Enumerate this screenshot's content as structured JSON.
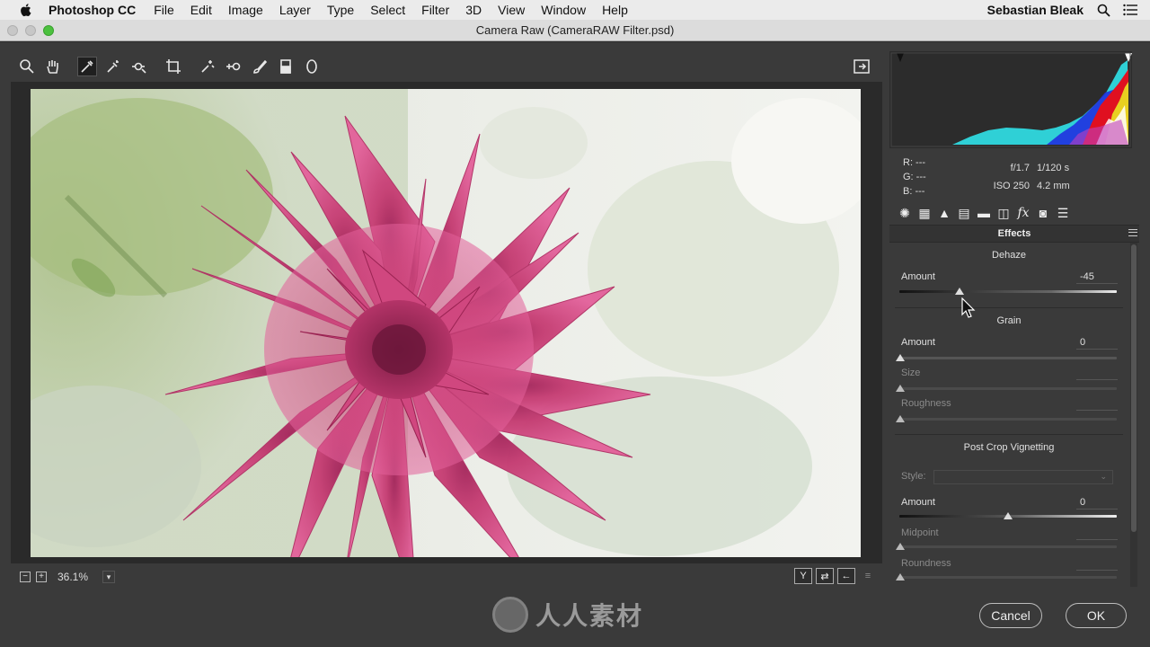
{
  "menubar": {
    "app_name": "Photoshop CC",
    "items": [
      "File",
      "Edit",
      "Image",
      "Layer",
      "Type",
      "Select",
      "Filter",
      "3D",
      "View",
      "Window",
      "Help"
    ],
    "user": "Sebastian Bleak"
  },
  "window": {
    "title": "Camera Raw (CameraRAW Filter.psd)"
  },
  "toolbar": {
    "tools": [
      "zoom-tool",
      "hand-tool",
      "white-balance-tool",
      "color-sampler-tool",
      "targeted-adjustment-tool",
      "crop-tool",
      "spot-removal-tool",
      "red-eye-tool",
      "adjustment-brush-tool",
      "graduated-filter-tool",
      "radial-filter-tool"
    ],
    "active_tool": "white-balance-tool"
  },
  "info": {
    "r": "R:  ---",
    "g": "G:  ---",
    "b": "B:  ---",
    "aperture": "f/1.7",
    "shutter": "1/120 s",
    "iso": "ISO 250",
    "focal": "4.2 mm"
  },
  "panel": {
    "title": "Effects",
    "dehaze": {
      "heading": "Dehaze",
      "amount_label": "Amount",
      "amount_value": "-45",
      "amount_fraction": 0.275
    },
    "grain": {
      "heading": "Grain",
      "amount_label": "Amount",
      "amount_value": "0",
      "size_label": "Size",
      "roughness_label": "Roughness"
    },
    "vignetting": {
      "heading": "Post Crop Vignetting",
      "style_label": "Style:",
      "amount_label": "Amount",
      "amount_value": "0",
      "midpoint_label": "Midpoint",
      "roundness_label": "Roundness"
    }
  },
  "statusbar": {
    "zoom": "36.1%"
  },
  "footer": {
    "cancel_label": "Cancel",
    "ok_label": "OK",
    "watermark": "人人素材"
  },
  "colors": {
    "accent_flower": "#d8427a",
    "panel_bg": "#3a3a3a"
  }
}
